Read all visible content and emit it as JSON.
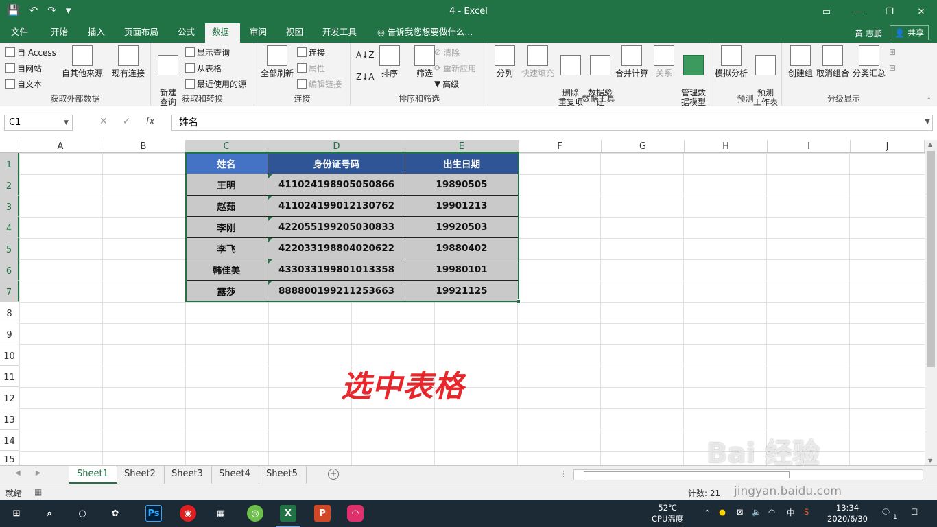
{
  "window": {
    "title": "4 - Excel",
    "controls": [
      "ribbon-display-icon",
      "minimize-icon",
      "restore-icon",
      "close-icon"
    ]
  },
  "qat": {
    "save": "💾",
    "undo": "↶",
    "redo": "↷",
    "more": "▾"
  },
  "tabs": [
    {
      "label": "文件",
      "active": false
    },
    {
      "label": "开始",
      "active": false
    },
    {
      "label": "插入",
      "active": false
    },
    {
      "label": "页面布局",
      "active": false
    },
    {
      "label": "公式",
      "active": false
    },
    {
      "label": "数据",
      "active": true
    },
    {
      "label": "审阅",
      "active": false
    },
    {
      "label": "视图",
      "active": false
    },
    {
      "label": "开发工具",
      "active": false
    }
  ],
  "tell_me": "告诉我您想要做什么...",
  "user": "黄 志鹏",
  "share": "共享",
  "ribbon": {
    "get_external": {
      "label": "获取外部数据",
      "access": "自 Access",
      "web": "自网站",
      "text": "自文本",
      "other": "自其他来源",
      "existing": "现有连接"
    },
    "get_transform": {
      "label": "获取和转换",
      "new_query": "新建\n查询",
      "show_query": "显示查询",
      "from_table": "从表格",
      "recent": "最近使用的源"
    },
    "connections": {
      "label": "连接",
      "refresh_all": "全部刷新",
      "connections": "连接",
      "properties": "属性",
      "edit_links": "编辑链接"
    },
    "sort_filter": {
      "label": "排序和筛选",
      "sort": "排序",
      "filter": "筛选",
      "clear": "清除",
      "reapply": "重新应用",
      "advanced": "高级"
    },
    "data_tools": {
      "label": "数据工具",
      "text_to_cols": "分列",
      "flash_fill": "快速填充",
      "remove_dup": "删除\n重复项",
      "validation": "数据验\n证",
      "consolidate": "合并计算",
      "relationships": "关系",
      "manage_model": "管理数\n据模型"
    },
    "forecast": {
      "label": "预测",
      "what_if": "模拟分析",
      "forecast_sheet": "预测\n工作表"
    },
    "outline": {
      "label": "分级显示",
      "group": "创建组",
      "ungroup": "取消组合",
      "subtotal": "分类汇总"
    }
  },
  "formula_bar": {
    "name_box": "C1",
    "formula": "姓名",
    "cancel": "✕",
    "enter": "✓",
    "fx": "fx"
  },
  "columns": [
    "A",
    "B",
    "C",
    "D",
    "E",
    "F",
    "G",
    "H",
    "I",
    "J"
  ],
  "rows": [
    "1",
    "2",
    "3",
    "4",
    "5",
    "6",
    "7",
    "8",
    "9",
    "10",
    "11",
    "12",
    "13",
    "14",
    "15"
  ],
  "table": {
    "headers": [
      "姓名",
      "身份证号码",
      "出生日期"
    ],
    "rows": [
      [
        "王明",
        "411024198905050866",
        "19890505"
      ],
      [
        "赵茹",
        "411024199012130762",
        "19901213"
      ],
      [
        "李刚",
        "422055199205030833",
        "19920503"
      ],
      [
        "李飞",
        "422033198804020622",
        "19880402"
      ],
      [
        "韩佳美",
        "433033199801013358",
        "19980101"
      ],
      [
        "露莎",
        "888800199211253663",
        "19921125"
      ]
    ]
  },
  "caption": "选中表格",
  "sheets": [
    {
      "label": "Sheet1",
      "active": true
    },
    {
      "label": "Sheet2",
      "active": false
    },
    {
      "label": "Sheet3",
      "active": false
    },
    {
      "label": "Sheet4",
      "active": false
    },
    {
      "label": "Sheet5",
      "active": false
    }
  ],
  "status": {
    "ready": "就绪",
    "count": "计数: 21"
  },
  "taskbar": {
    "temp": "52℃",
    "temp_label": "CPU温度",
    "ime": "中",
    "time": "13:34",
    "date": "2020/6/30",
    "notifications": "1"
  },
  "watermark": {
    "logo": "Bai 经验",
    "url": "jingyan.baidu.com"
  },
  "colors": {
    "excel_green": "#217346",
    "header_blue": "#2f5597",
    "header_first_blue": "#4472c4",
    "cell_gray": "#c9c9c9",
    "caption_red": "#e8272d"
  }
}
